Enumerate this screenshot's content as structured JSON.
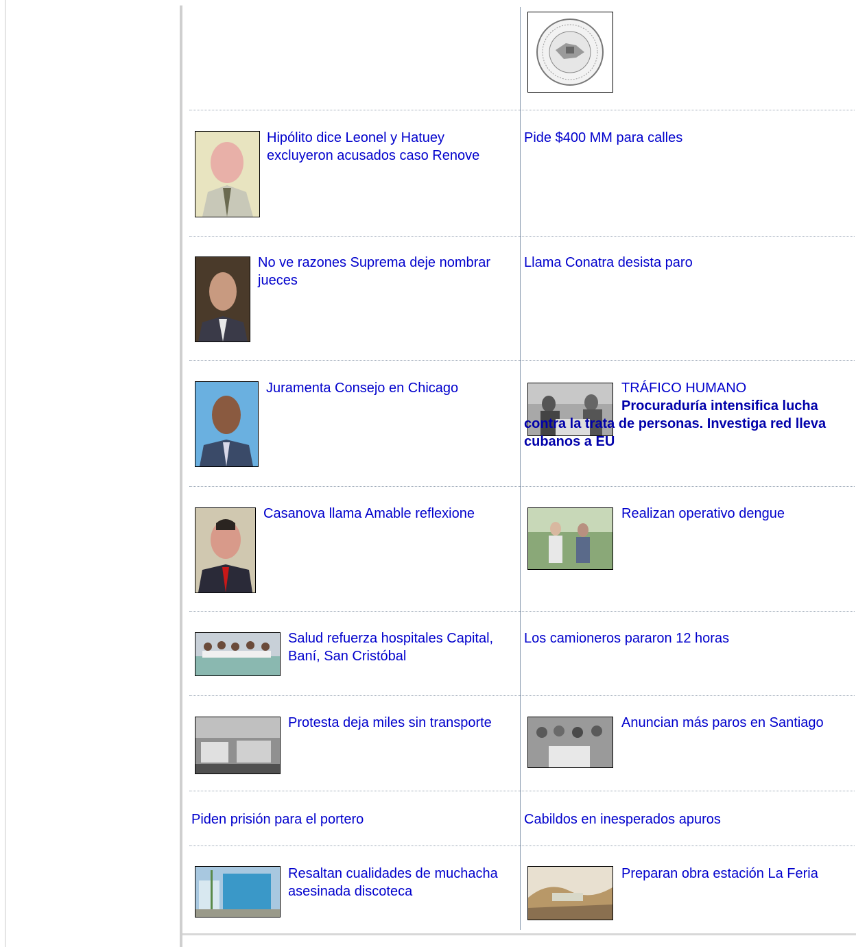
{
  "news": {
    "left": [
      {
        "title": "Hipólito dice Leonel y Hatuey excluyeron acusados caso Renove",
        "thumb": "portrait-icon"
      },
      {
        "title": "No ve razones Suprema deje nombrar jueces",
        "thumb": "portrait-icon"
      },
      {
        "title": "Juramenta Consejo en Chicago",
        "thumb": "portrait-icon"
      },
      {
        "title": "Casanova llama Amable reflexione",
        "thumb": "portrait-icon"
      },
      {
        "title": "Salud refuerza hospitales Capital, Baní, San Cristóbal",
        "thumb": "group-photo-icon"
      },
      {
        "title": "Protesta deja miles sin transporte",
        "thumb": "street-photo-icon"
      },
      {
        "title": "Piden prisión para el portero"
      },
      {
        "title": "Resaltan cualidades de muchacha asesinada discoteca",
        "thumb": "building-photo-icon"
      }
    ],
    "right": [
      {
        "thumb": "seal-logo-icon"
      },
      {
        "title": "Pide $400 MM para calles"
      },
      {
        "title": "Llama Conatra desista paro"
      },
      {
        "kicker": "TRÁFICO HUMANO",
        "title": "Procuraduría intensifica lucha contra la trata de personas. Investiga red lleva cubanos a EU",
        "thumb": "meeting-photo-icon"
      },
      {
        "title": "Realizan operativo dengue",
        "thumb": "people-photo-icon"
      },
      {
        "title": "Los camioneros pararon 12 horas"
      },
      {
        "title": "Anuncian más paros en Santiago",
        "thumb": "group-photo-icon"
      },
      {
        "title": "Cabildos en inesperados apuros"
      },
      {
        "title": "Preparan obra estación La Feria",
        "thumb": "landscape-photo-icon"
      }
    ]
  }
}
